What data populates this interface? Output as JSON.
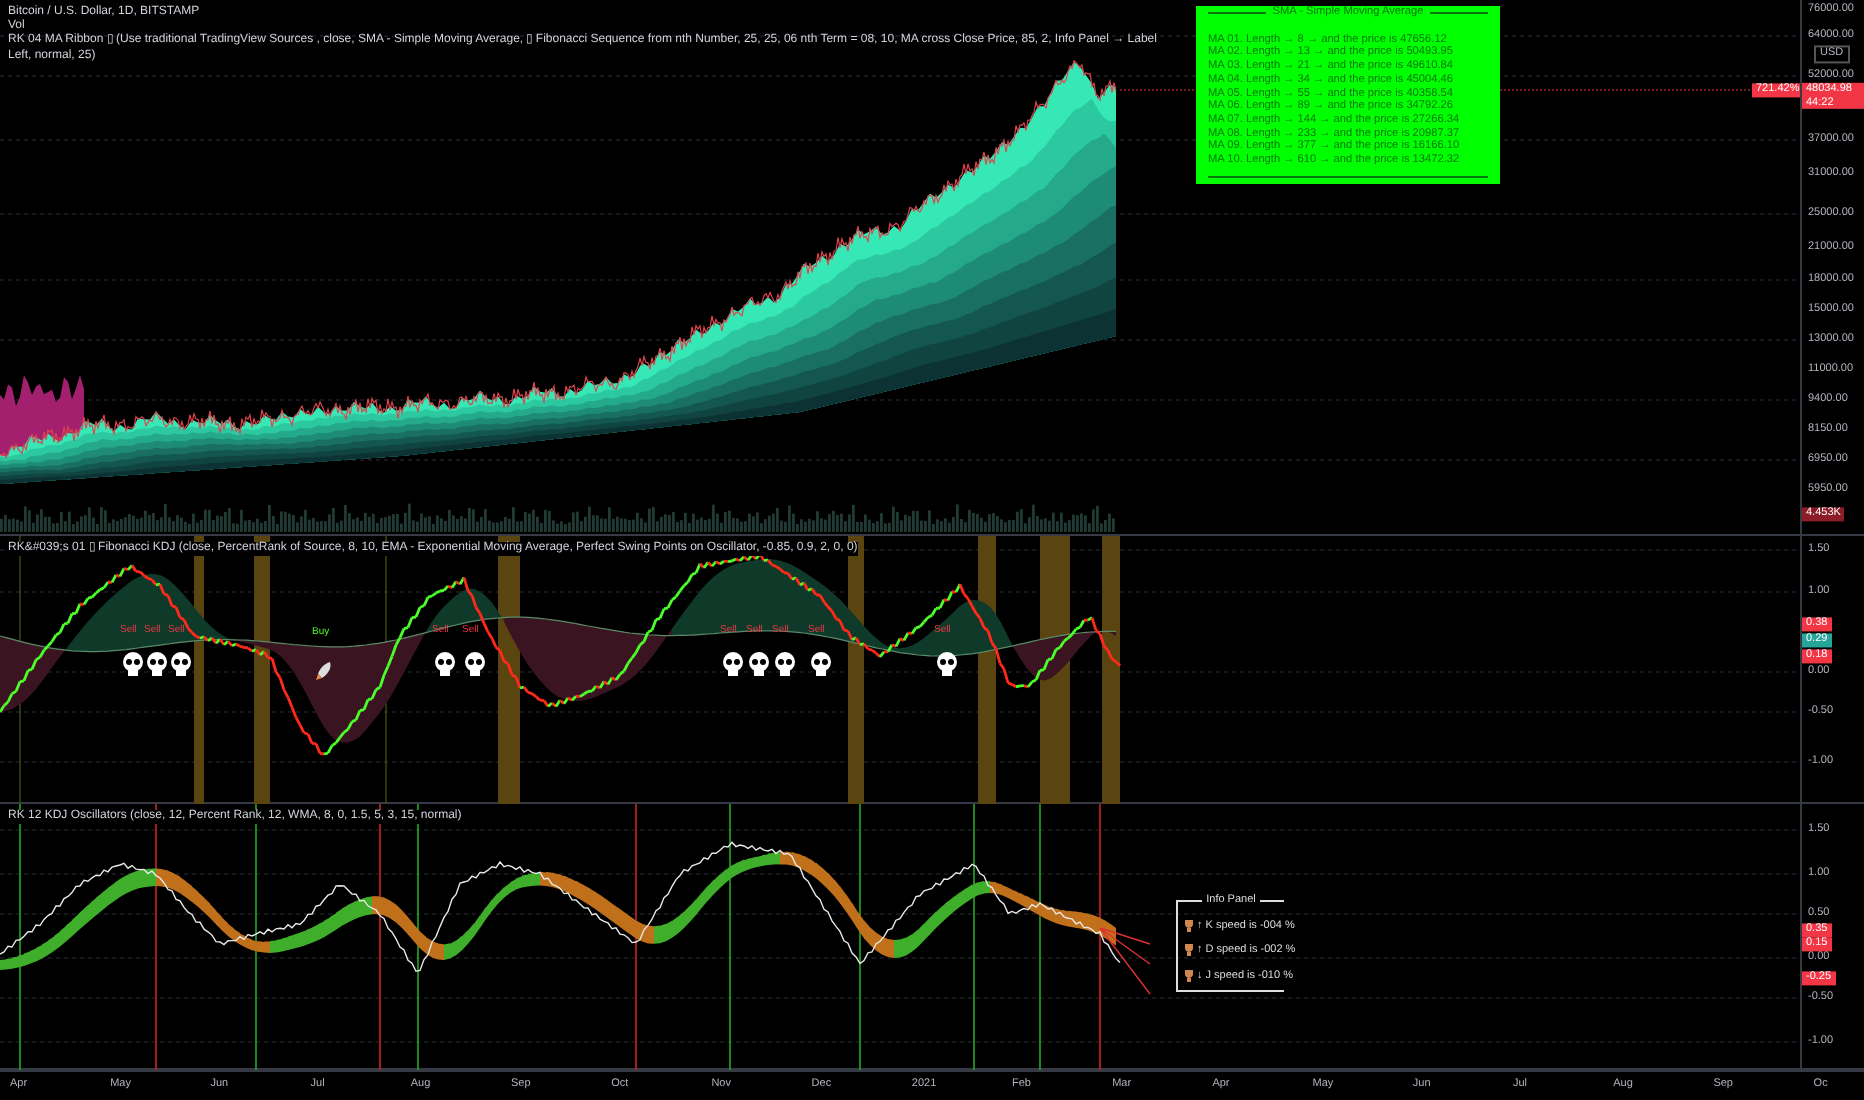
{
  "header": {
    "symbol": "Bitcoin / U.S. Dollar, 1D, BITSTAMP",
    "volume": "Vol",
    "indicator": "RK 04 MA Ribbon ▯ (Use traditional TradingView Sources , close, SMA - Simple Moving Average, ▯ Fibonacci Sequence from nth Number, 25, 25, 06 nth Term = 08, 10, MA cross Close Price, 85, 2, Info Panel → Label Left, normal, 25)"
  },
  "ma_panel": {
    "title": "SMA - Simple Moving Average",
    "rows": [
      {
        "text": "MA 01. Length → 8 → and the price is 47656.12"
      },
      {
        "text": "MA 02. Length → 13 → and the price is 50493.95"
      },
      {
        "text": "MA 03. Length → 21 → and the price is 49610.84"
      },
      {
        "text": "MA 04. Length → 34 → and the price is 45004.46"
      },
      {
        "text": "MA 05. Length → 55 → and the price is 40358.54"
      },
      {
        "text": "MA 06. Length → 89 → and the price is 34792.26"
      },
      {
        "text": "MA 07. Length → 144 → and the price is 27266.34"
      },
      {
        "text": "MA 08. Length → 233 → and the price is 20987.37"
      },
      {
        "text": "MA 09. Length → 377 → and the price is 16166.10"
      },
      {
        "text": "MA 10. Length → 610 → and the price is 13472.32"
      }
    ]
  },
  "price_axis": {
    "ticks": [
      "76000.00",
      "64000.00",
      "52000.00",
      "37000.00",
      "31000.00",
      "25000.00",
      "21000.00",
      "18000.00",
      "15000.00",
      "13000.00",
      "11000.00",
      "9400.00",
      "8150.00",
      "6950.00",
      "5950.00"
    ],
    "currency": "USD",
    "last_price": "48034.98",
    "countdown": "44:22",
    "change_label": "721.42%",
    "volume_label": "4.453K"
  },
  "kdj_pane": {
    "title": "RK&#039;s 01 ▯ Fibonacci KDJ (close, PercentRank of Source, 8, 10, EMA - Exponential Moving Average, Perfect Swing Points on Oscillator, -0.85, 0.9, 2, 0, 0)",
    "signals": [
      {
        "kind": "sell",
        "text": "Sell"
      },
      {
        "kind": "sell",
        "text": "Sell"
      },
      {
        "kind": "sell",
        "text": "Sell"
      },
      {
        "kind": "buy",
        "text": "Buy"
      },
      {
        "kind": "sell",
        "text": "Sell"
      },
      {
        "kind": "sell",
        "text": "Sell"
      },
      {
        "kind": "sell",
        "text": "Sell"
      },
      {
        "kind": "sell",
        "text": "Sell"
      },
      {
        "kind": "sell",
        "text": "Sell"
      },
      {
        "kind": "sell",
        "text": "Sell"
      },
      {
        "kind": "sell",
        "text": "Sell"
      }
    ],
    "ticks": [
      "1.50",
      "1.00",
      "0.00",
      "-0.50",
      "-1.00"
    ],
    "value_labels": [
      {
        "text": "0.38",
        "color": "#f23645"
      },
      {
        "text": "0.29",
        "color": "#26a69a"
      },
      {
        "text": "0.18",
        "color": "#f23645"
      }
    ]
  },
  "osc_pane": {
    "title": "RK 12 KDJ Oscillators (close, 12, Percent Rank, 12, WMA, 8, 0, 1.5, 5, 3, 15, normal)",
    "ticks": [
      "1.50",
      "1.00",
      "0.50",
      "0.00",
      "-0.50",
      "-1.00"
    ],
    "value_labels": [
      {
        "text": "0.35",
        "color": "#f23645"
      },
      {
        "text": "0.15",
        "color": "#f23645"
      },
      {
        "text": "-0.25",
        "color": "#f23645"
      }
    ],
    "info_panel": {
      "title": "Info Panel",
      "rows": [
        {
          "arrow": "↑",
          "text": "K speed is -004 %"
        },
        {
          "arrow": "↑",
          "text": "D speed is -002 %"
        },
        {
          "arrow": "↓",
          "text": "J speed is -010 %"
        }
      ]
    }
  },
  "time_axis": {
    "labels": [
      "Apr",
      "May",
      "Jun",
      "Jul",
      "Aug",
      "Sep",
      "Oct",
      "Nov",
      "Dec",
      "2021",
      "Feb",
      "Mar",
      "Apr",
      "May",
      "Jun",
      "Jul",
      "Aug",
      "Sep",
      "Oc"
    ]
  }
}
